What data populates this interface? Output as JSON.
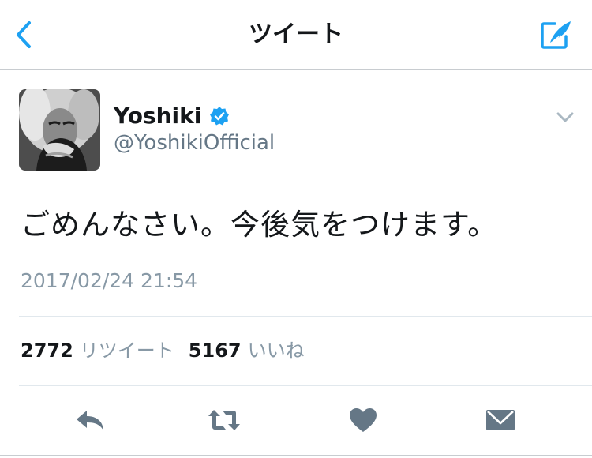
{
  "nav": {
    "title": "ツイート",
    "back_icon": "chevron-left-icon",
    "compose_icon": "compose-tweet-icon",
    "accent_color": "#1da1f2"
  },
  "tweet": {
    "display_name": "Yoshiki",
    "verified": true,
    "handle": "@YoshikiOfficial",
    "text": "ごめんなさい。今後気をつけます。",
    "timestamp": "2017/02/24 21:54"
  },
  "stats": {
    "retweet_count": "2772",
    "retweet_label": "リツイート",
    "like_count": "5167",
    "like_label": "いいね"
  },
  "actions": {
    "reply_icon": "reply-icon",
    "retweet_icon": "retweet-icon",
    "like_icon": "heart-icon",
    "dm_icon": "envelope-icon",
    "icon_color": "#657786"
  }
}
